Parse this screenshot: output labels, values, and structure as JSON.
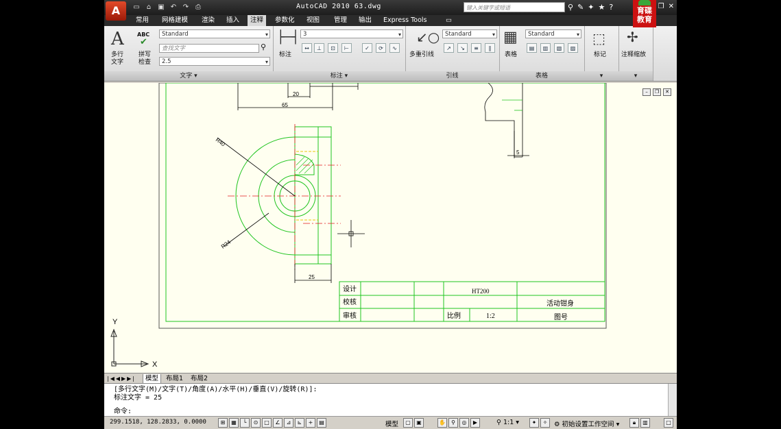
{
  "app": {
    "logo": "A",
    "title": "AutoCAD 2010   63.dwg",
    "search_placeholder": "键入关键字或短语",
    "brand_line1": "育",
    "brand_line2": "碟",
    "brand_line3": "教育"
  },
  "tabs": [
    "常用",
    "网格建模",
    "渲染",
    "插入",
    "注释",
    "参数化",
    "视图",
    "管理",
    "输出",
    "Express Tools"
  ],
  "active_tab": "注释",
  "ribbon": {
    "text_panel": {
      "title": "文字",
      "mtext_label_1": "多行",
      "mtext_label_2": "文字",
      "spell_icon_text": "ABC",
      "spell_label_1": "拼写",
      "spell_label_2": "检查",
      "style": "Standard",
      "find_placeholder": "查找文字",
      "height": "2.5"
    },
    "dim_panel": {
      "title": "标注",
      "dim_label": "标注",
      "dim_style": "3"
    },
    "leader_panel": {
      "title": "引线",
      "mleader_label": "多重引线",
      "style": "Standard"
    },
    "table_panel": {
      "title": "表格",
      "table_label": "表格",
      "style": "Standard"
    },
    "markup_panel": {
      "label": "标记"
    },
    "scale_panel": {
      "label": "注释缩放"
    }
  },
  "drawing": {
    "dims": {
      "d20": "20",
      "d65": "65",
      "r40": "R40",
      "r24": "R24",
      "d25": "25",
      "d5": "5"
    },
    "title_block": {
      "design": "设计",
      "check": "校核",
      "review": "审核",
      "material": "HT200",
      "part_name": "活动钳身",
      "scale_label": "比例",
      "scale_value": "1:2",
      "drawing_no": "图号"
    },
    "ucs": {
      "x": "X",
      "y": "Y"
    }
  },
  "layout_tabs": [
    "模型",
    "布局1",
    "布局2"
  ],
  "command": {
    "line1": "[多行文字(M)/文字(T)/角度(A)/水平(H)/垂直(V)/旋转(R)]:",
    "line2": "标注文字 = 25",
    "prompt": "命令:"
  },
  "status": {
    "coords": "299.1518, 128.2833, 0.0000",
    "model": "模型",
    "scale": "1:1",
    "workspace": "初始设置工作空间"
  }
}
